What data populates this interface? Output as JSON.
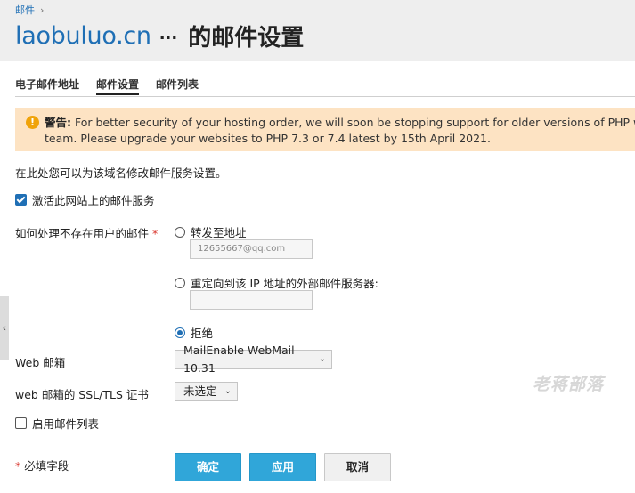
{
  "header": {
    "breadcrumb": "邮件",
    "domain": "laobuluo.cn",
    "more": "...",
    "title": "的邮件设置"
  },
  "tabs": [
    {
      "label": "电子邮件地址",
      "active": false
    },
    {
      "label": "邮件设置",
      "active": true
    },
    {
      "label": "邮件列表",
      "active": false
    }
  ],
  "warning": {
    "label": "警告:",
    "line1": "For better security of your hosting order, we will soon be stopping support for older versions of PHP which are no longer supported by the PHP",
    "line2": "team. Please upgrade your websites to PHP 7.3 or 7.4 latest by 15th April 2021."
  },
  "description": "在此处您可以为该域名修改邮件服务设置。",
  "activate": {
    "label": "激活此网站上的邮件服务",
    "checked": true
  },
  "nonexistent": {
    "label": "如何处理不存在用户的邮件",
    "required_mark": "*",
    "options": [
      {
        "label": "转发至地址",
        "selected": false
      },
      {
        "label": "重定向到该 IP 地址的外部邮件服务器:",
        "selected": false
      },
      {
        "label": "拒绝",
        "selected": true
      }
    ],
    "forward_value": "12655667@qq.com",
    "redirect_value": ""
  },
  "webmail": {
    "label": "Web 邮箱",
    "value": "MailEnable WebMail 10.31"
  },
  "ssl": {
    "label": "web 邮箱的 SSL/TLS 证书",
    "value": "未选定"
  },
  "mailing_list": {
    "label": "启用邮件列表",
    "checked": false
  },
  "required_note": {
    "mark": "*",
    "text": "必填字段"
  },
  "buttons": {
    "ok": "确定",
    "apply": "应用",
    "cancel": "取消"
  },
  "watermark": "老蒋部落",
  "side_handle": "‹",
  "colors": {
    "accent": "#1f6fb5",
    "primary_button": "#30a6d9",
    "warning_bg": "#fde3c3"
  }
}
